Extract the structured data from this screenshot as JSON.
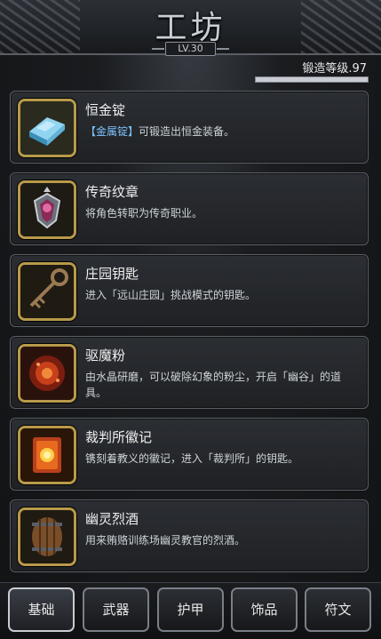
{
  "header": {
    "title": "工坊",
    "level": "LV.30"
  },
  "forge": {
    "label": "锻造等级.97",
    "progress": 1.0
  },
  "items": [
    {
      "name": "恒金锭",
      "desc_pre": "",
      "desc_hl": "【金属锭】",
      "desc_post": "可锻造出恒金装备。",
      "icon": "metal-ingot-icon"
    },
    {
      "name": "传奇纹章",
      "desc_pre": "将角色转职为传奇职业。",
      "desc_hl": "",
      "desc_post": "",
      "icon": "legend-crest-icon"
    },
    {
      "name": "庄园钥匙",
      "desc_pre": "进入「远山庄园」挑战模式的钥匙。",
      "desc_hl": "",
      "desc_post": "",
      "icon": "manor-key-icon"
    },
    {
      "name": "驱魔粉",
      "desc_pre": "由水晶研磨，可以破除幻象的粉尘，开启「幽谷」的道具。",
      "desc_hl": "",
      "desc_post": "",
      "icon": "exorcism-powder-icon"
    },
    {
      "name": "裁判所徽记",
      "desc_pre": "镌刻着教义的徽记，进入「裁判所」的钥匙。",
      "desc_hl": "",
      "desc_post": "",
      "icon": "tribunal-emblem-icon"
    },
    {
      "name": "幽灵烈酒",
      "desc_pre": "用来贿赂训练场幽灵教官的烈酒。",
      "desc_hl": "",
      "desc_post": "",
      "icon": "ghost-liquor-barrel-icon"
    }
  ],
  "tabs": [
    {
      "label": "基础",
      "active": true
    },
    {
      "label": "武器",
      "active": false
    },
    {
      "label": "护甲",
      "active": false
    },
    {
      "label": "饰品",
      "active": false
    },
    {
      "label": "符文",
      "active": false
    }
  ]
}
